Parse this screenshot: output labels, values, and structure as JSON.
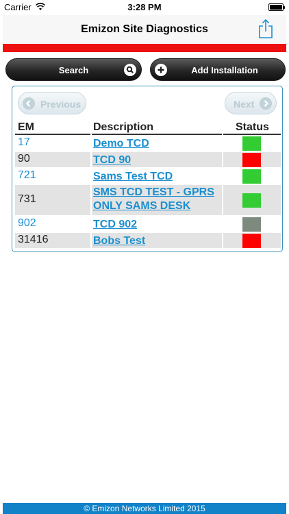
{
  "status_bar": {
    "carrier": "Carrier",
    "time": "3:28 PM"
  },
  "nav": {
    "title": "Emizon Site Diagnostics"
  },
  "actions": {
    "search_label": "Search",
    "add_label": "Add Installation"
  },
  "pager": {
    "previous_label": "Previous",
    "next_label": "Next"
  },
  "table": {
    "columns": [
      "EM",
      "Description",
      "Status"
    ],
    "rows": [
      {
        "em": "17",
        "description": "Demo TCD",
        "status": "green"
      },
      {
        "em": "90",
        "description": "TCD 90",
        "status": "red"
      },
      {
        "em": "721",
        "description": "Sams Test TCD",
        "status": "green"
      },
      {
        "em": "731",
        "description": "SMS TCD TEST - GPRS ONLY SAMS DESK",
        "status": "green"
      },
      {
        "em": "902",
        "description": "TCD 902",
        "status": "grey"
      },
      {
        "em": "31416",
        "description": "Bobs Test",
        "status": "red"
      }
    ]
  },
  "footer": {
    "text": "© Emizon Networks Limited 2015"
  },
  "colors": {
    "accent": "#1a8fd0",
    "alert_bar": "#ee1111",
    "status_green": "#33cc33",
    "status_red": "#ff0000",
    "status_grey": "#7f8a7f",
    "row_alt": "#e3e3e3",
    "footer_bg": "#1181c8"
  }
}
